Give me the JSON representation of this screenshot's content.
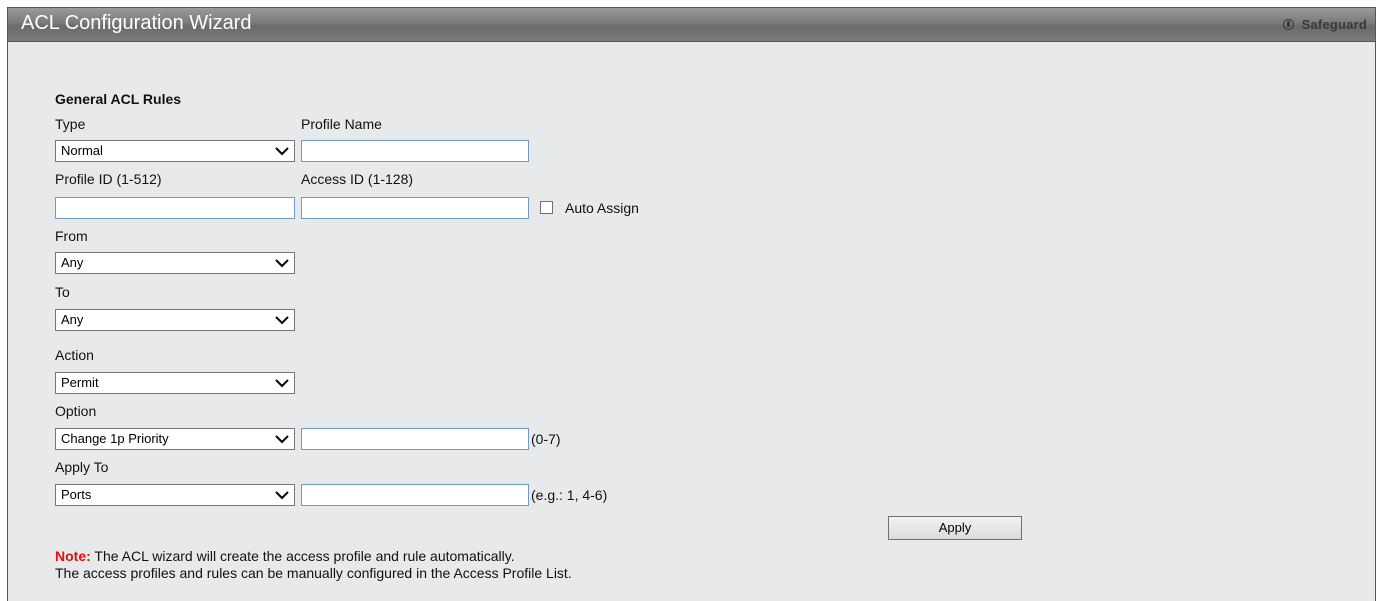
{
  "window": {
    "title": "ACL Configuration Wizard",
    "safeguard_label": "Safeguard"
  },
  "form": {
    "section_title": "General ACL Rules",
    "type": {
      "label": "Type",
      "value": "Normal"
    },
    "profile_name": {
      "label": "Profile Name",
      "value": ""
    },
    "profile_id": {
      "label": "Profile ID (1-512)",
      "value": ""
    },
    "access_id": {
      "label": "Access ID (1-128)",
      "value": ""
    },
    "auto_assign": {
      "label": "Auto Assign",
      "checked": false
    },
    "from": {
      "label": "From",
      "value": "Any"
    },
    "to": {
      "label": "To",
      "value": "Any"
    },
    "action": {
      "label": "Action",
      "value": "Permit"
    },
    "option": {
      "label": "Option",
      "value": "Change 1p Priority",
      "input_value": "",
      "hint": "(0-7)"
    },
    "apply_to": {
      "label": "Apply To",
      "value": "Ports",
      "input_value": "",
      "hint": "(e.g.: 1, 4-6)"
    },
    "apply_label": "Apply"
  },
  "note": {
    "prefix": "Note:",
    "line1": " The ACL wizard will create the access profile and rule automatically.",
    "line2": "The access profiles and rules can be manually configured in the Access Profile List."
  }
}
